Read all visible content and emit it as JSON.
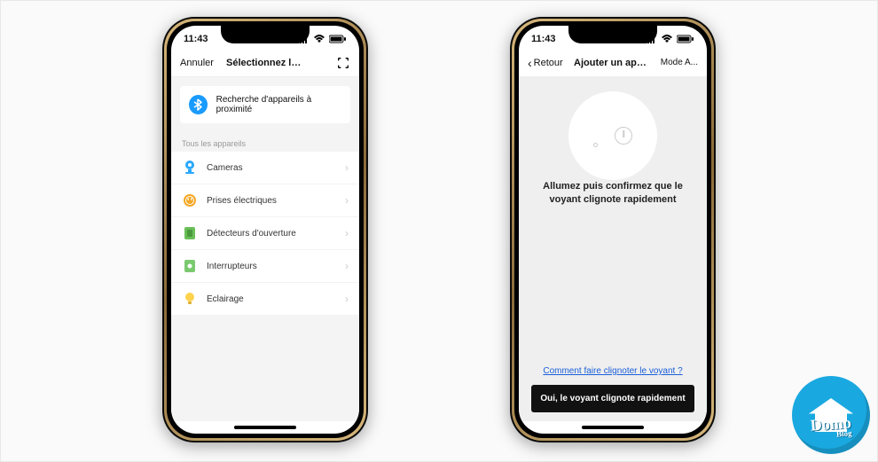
{
  "status": {
    "time": "11:43"
  },
  "left": {
    "nav": {
      "cancel": "Annuler",
      "title": "Sélectionnez le typ..."
    },
    "bluetooth_search": "Recherche d'appareils à proximité",
    "all_devices_header": "Tous les appareils",
    "categories": [
      {
        "label": "Cameras"
      },
      {
        "label": "Prises électriques"
      },
      {
        "label": "Détecteurs d'ouverture"
      },
      {
        "label": "Interrupteurs"
      },
      {
        "label": "Eclairage"
      }
    ]
  },
  "right": {
    "nav": {
      "back": "Retour",
      "title": "Ajouter un appareil",
      "mode": "Mode A..."
    },
    "instruction": "Allumez puis confirmez que le voyant clignote rapidement",
    "help_link": "Comment faire clignoter le voyant ?",
    "confirm_button": "Oui, le voyant clignote rapidement"
  },
  "brand": {
    "name": "Domo",
    "sub": "Blog"
  }
}
